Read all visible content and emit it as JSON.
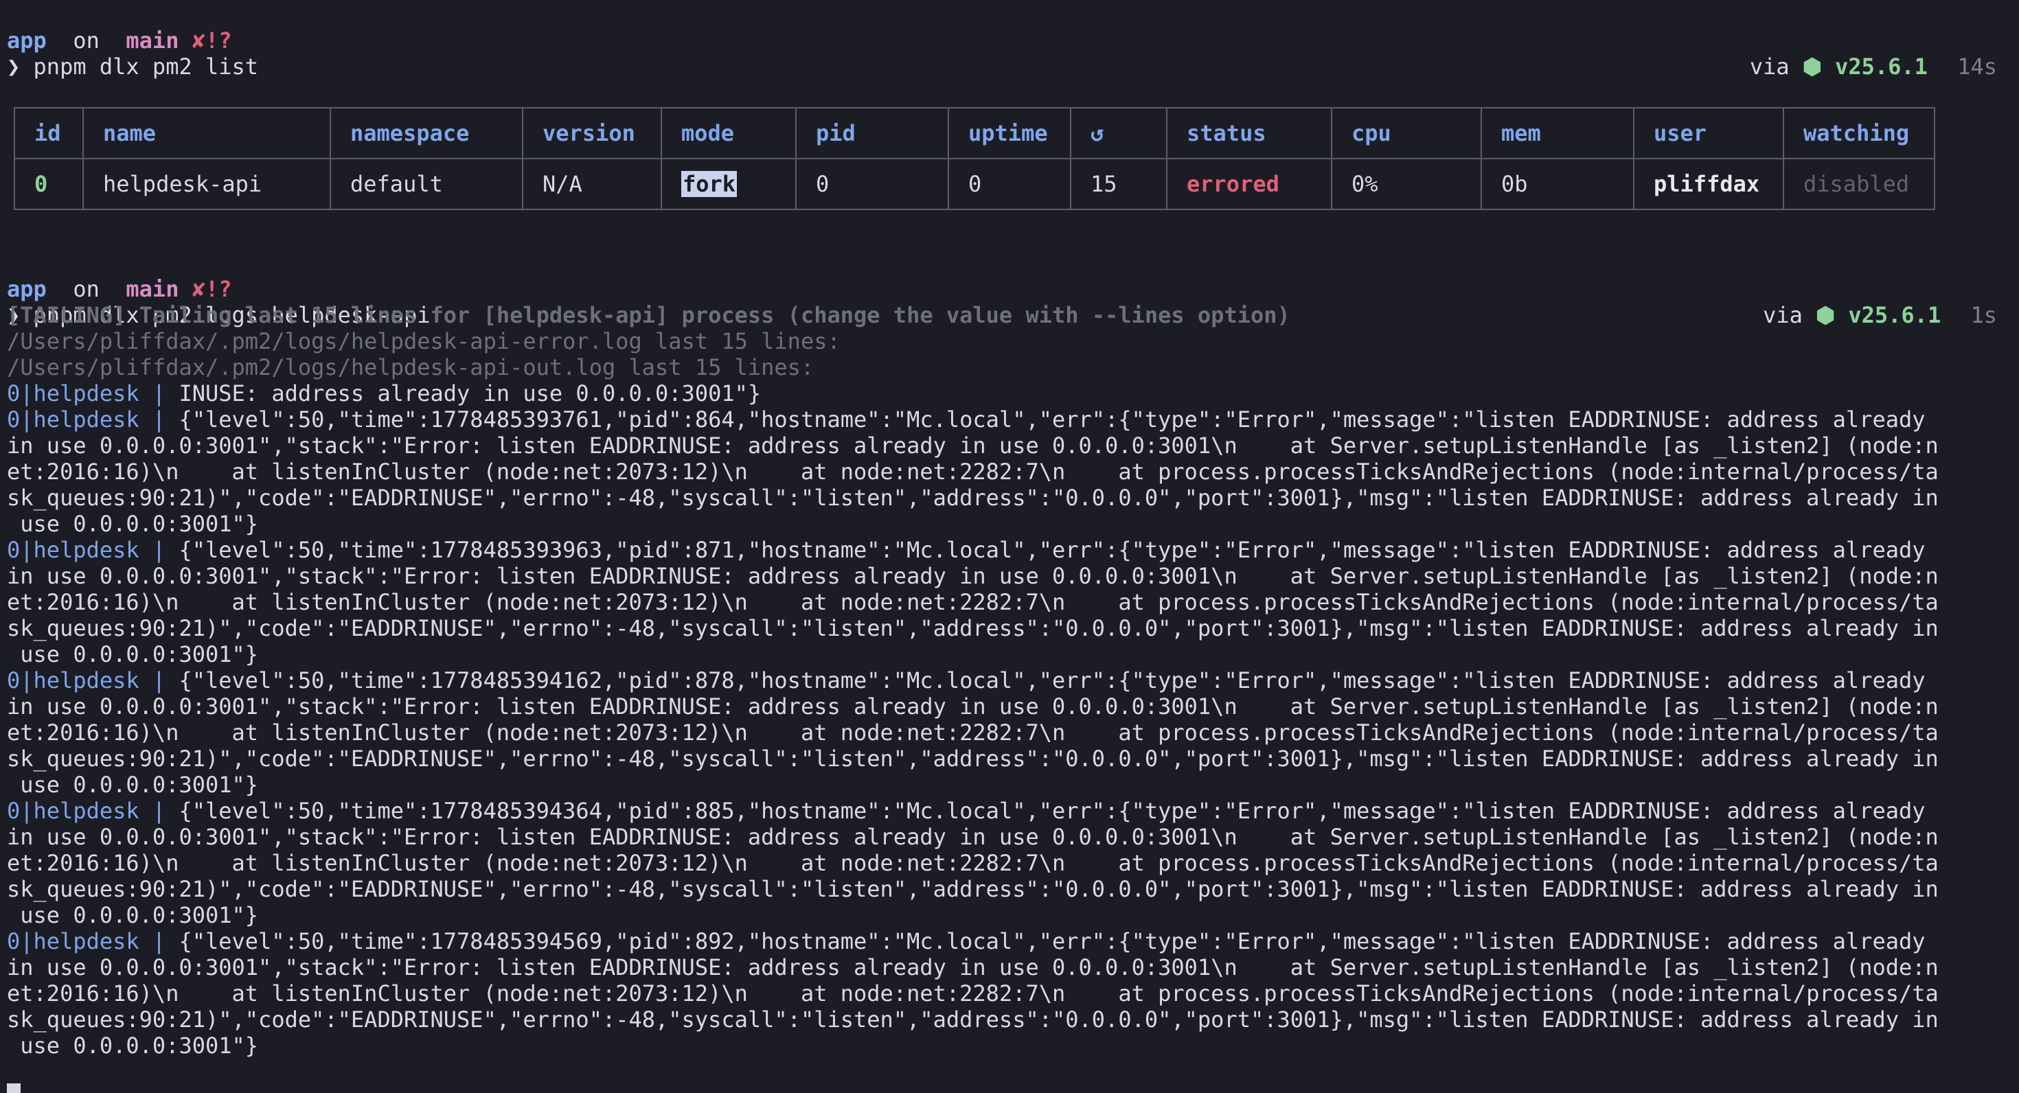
{
  "prompt1": {
    "dir": "app",
    "on": "on",
    "branch_icon": "",
    "branch": "main",
    "status": "✘!?",
    "symbol": "❯",
    "command": "pnpm dlx pm2 list",
    "via": "via",
    "node_icon": "⬢",
    "node_version": "v25.6.1",
    "duration": "14s"
  },
  "pm2_table": {
    "headers": [
      "id",
      "name",
      "namespace",
      "version",
      "mode",
      "pid",
      "uptime",
      "↺",
      "status",
      "cpu",
      "mem",
      "user",
      "watching"
    ],
    "row": {
      "id": "0",
      "name": "helpdesk-api",
      "namespace": "default",
      "version": "N/A",
      "mode": "fork",
      "pid": "0",
      "uptime": "0",
      "restarts": "15",
      "status": "errored",
      "cpu": "0%",
      "mem": "0b",
      "user": "pliffdax",
      "watching": "disabled"
    }
  },
  "prompt2": {
    "dir": "app",
    "on": "on",
    "branch_icon": "",
    "branch": "main",
    "status": "✘!?",
    "symbol": "❯",
    "command": "pnpm dlx pm2 logs helpdesk-api",
    "via": "via",
    "node_icon": "⬢",
    "node_version": "v25.6.1",
    "duration": "1s"
  },
  "log_header": [
    "[TAILING] Tailing last 15 lines for [helpdesk-api] process (change the value with --lines option)",
    "/Users/pliffdax/.pm2/logs/helpdesk-api-error.log last 15 lines:",
    "/Users/pliffdax/.pm2/logs/helpdesk-api-out.log last 15 lines:"
  ],
  "log_prefix": "0|helpdesk | ",
  "log_lines": [
    "INUSE: address already in use 0.0.0.0:3001\"}",
    "{\"level\":50,\"time\":1778485393761,\"pid\":864,\"hostname\":\"Mc.local\",\"err\":{\"type\":\"Error\",\"message\":\"listen EADDRINUSE: address already",
    "in use 0.0.0.0:3001\",\"stack\":\"Error: listen EADDRINUSE: address already in use 0.0.0.0:3001\\n    at Server.setupListenHandle [as _listen2] (node:n",
    "et:2016:16)\\n    at listenInCluster (node:net:2073:12)\\n    at node:net:2282:7\\n    at process.processTicksAndRejections (node:internal/process/ta",
    "sk_queues:90:21)\",\"code\":\"EADDRINUSE\",\"errno\":-48,\"syscall\":\"listen\",\"address\":\"0.0.0.0\",\"port\":3001},\"msg\":\"listen EADDRINUSE: address already in",
    " use 0.0.0.0:3001\"}",
    "{\"level\":50,\"time\":1778485393963,\"pid\":871,\"hostname\":\"Mc.local\",\"err\":{\"type\":\"Error\",\"message\":\"listen EADDRINUSE: address already",
    "in use 0.0.0.0:3001\",\"stack\":\"Error: listen EADDRINUSE: address already in use 0.0.0.0:3001\\n    at Server.setupListenHandle [as _listen2] (node:n",
    "et:2016:16)\\n    at listenInCluster (node:net:2073:12)\\n    at node:net:2282:7\\n    at process.processTicksAndRejections (node:internal/process/ta",
    "sk_queues:90:21)\",\"code\":\"EADDRINUSE\",\"errno\":-48,\"syscall\":\"listen\",\"address\":\"0.0.0.0\",\"port\":3001},\"msg\":\"listen EADDRINUSE: address already in",
    " use 0.0.0.0:3001\"}",
    "{\"level\":50,\"time\":1778485394162,\"pid\":878,\"hostname\":\"Mc.local\",\"err\":{\"type\":\"Error\",\"message\":\"listen EADDRINUSE: address already",
    "in use 0.0.0.0:3001\",\"stack\":\"Error: listen EADDRINUSE: address already in use 0.0.0.0:3001\\n    at Server.setupListenHandle [as _listen2] (node:n",
    "et:2016:16)\\n    at listenInCluster (node:net:2073:12)\\n    at node:net:2282:7\\n    at process.processTicksAndRejections (node:internal/process/ta",
    "sk_queues:90:21)\",\"code\":\"EADDRINUSE\",\"errno\":-48,\"syscall\":\"listen\",\"address\":\"0.0.0.0\",\"port\":3001},\"msg\":\"listen EADDRINUSE: address already in",
    " use 0.0.0.0:3001\"}",
    "{\"level\":50,\"time\":1778485394364,\"pid\":885,\"hostname\":\"Mc.local\",\"err\":{\"type\":\"Error\",\"message\":\"listen EADDRINUSE: address already",
    "in use 0.0.0.0:3001\",\"stack\":\"Error: listen EADDRINUSE: address already in use 0.0.0.0:3001\\n    at Server.setupListenHandle [as _listen2] (node:n",
    "et:2016:16)\\n    at listenInCluster (node:net:2073:12)\\n    at node:net:2282:7\\n    at process.processTicksAndRejections (node:internal/process/ta",
    "sk_queues:90:21)\",\"code\":\"EADDRINUSE\",\"errno\":-48,\"syscall\":\"listen\",\"address\":\"0.0.0.0\",\"port\":3001},\"msg\":\"listen EADDRINUSE: address already in",
    " use 0.0.0.0:3001\"}",
    "{\"level\":50,\"time\":1778485394569,\"pid\":892,\"hostname\":\"Mc.local\",\"err\":{\"type\":\"Error\",\"message\":\"listen EADDRINUSE: address already",
    "in use 0.0.0.0:3001\",\"stack\":\"Error: listen EADDRINUSE: address already in use 0.0.0.0:3001\\n    at Server.setupListenHandle [as _listen2] (node:n",
    "et:2016:16)\\n    at listenInCluster (node:net:2073:12)\\n    at node:net:2282:7\\n    at process.processTicksAndRejections (node:internal/process/ta",
    "sk_queues:90:21)\",\"code\":\"EADDRINUSE\",\"errno\":-48,\"syscall\":\"listen\",\"address\":\"0.0.0.0\",\"port\":3001},\"msg\":\"listen EADDRINUSE: address already in",
    " use 0.0.0.0:3001\"}"
  ],
  "log_line_has_prefix": [
    true,
    true,
    false,
    false,
    false,
    false,
    true,
    false,
    false,
    false,
    false,
    true,
    false,
    false,
    false,
    false,
    true,
    false,
    false,
    false,
    false,
    true,
    false,
    false,
    false,
    false
  ],
  "colors": {
    "background": "#1c1d24",
    "directory": "#82a8f0",
    "branch": "#d98cc5",
    "git_status": "#e0607a",
    "node": "#8fd19a",
    "table_header": "#7fa6ec",
    "errored": "#e0607a",
    "log_prefix": "#7da4ea",
    "dim": "#6c6f7d"
  }
}
